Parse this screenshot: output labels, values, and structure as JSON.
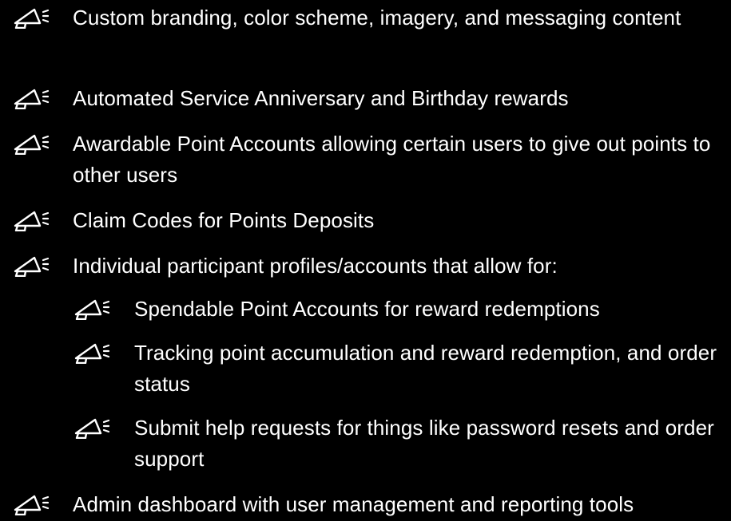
{
  "features": {
    "items": [
      {
        "text": "Custom branding, color scheme, imagery, and messaging content",
        "icon": "megaphone-icon",
        "level": 1
      },
      {
        "text": "Automated Service Anniversary and Birthday rewards",
        "icon": "megaphone-icon",
        "level": 1
      },
      {
        "text": "Awardable Point Accounts allowing certain users to give out points to other users",
        "icon": "megaphone-icon",
        "level": 1
      },
      {
        "text": "Claim Codes for Points Deposits",
        "icon": "megaphone-icon",
        "level": 1
      },
      {
        "text": "Individual participant profiles/accounts that allow for:",
        "icon": "megaphone-icon",
        "level": 1
      },
      {
        "text": "Spendable Point Accounts for reward redemptions",
        "icon": "megaphone-icon",
        "level": 2
      },
      {
        "text": "Tracking point accumulation and reward redemption, and order status",
        "icon": "megaphone-icon",
        "level": 2
      },
      {
        "text": "Submit help requests for things like password resets and order support",
        "icon": "megaphone-icon",
        "level": 2
      },
      {
        "text": "Admin dashboard with user management and reporting tools",
        "icon": "megaphone-icon",
        "level": 1
      }
    ]
  },
  "colors": {
    "background": "#000000",
    "text": "#ffffff",
    "icon": "#ffffff"
  }
}
